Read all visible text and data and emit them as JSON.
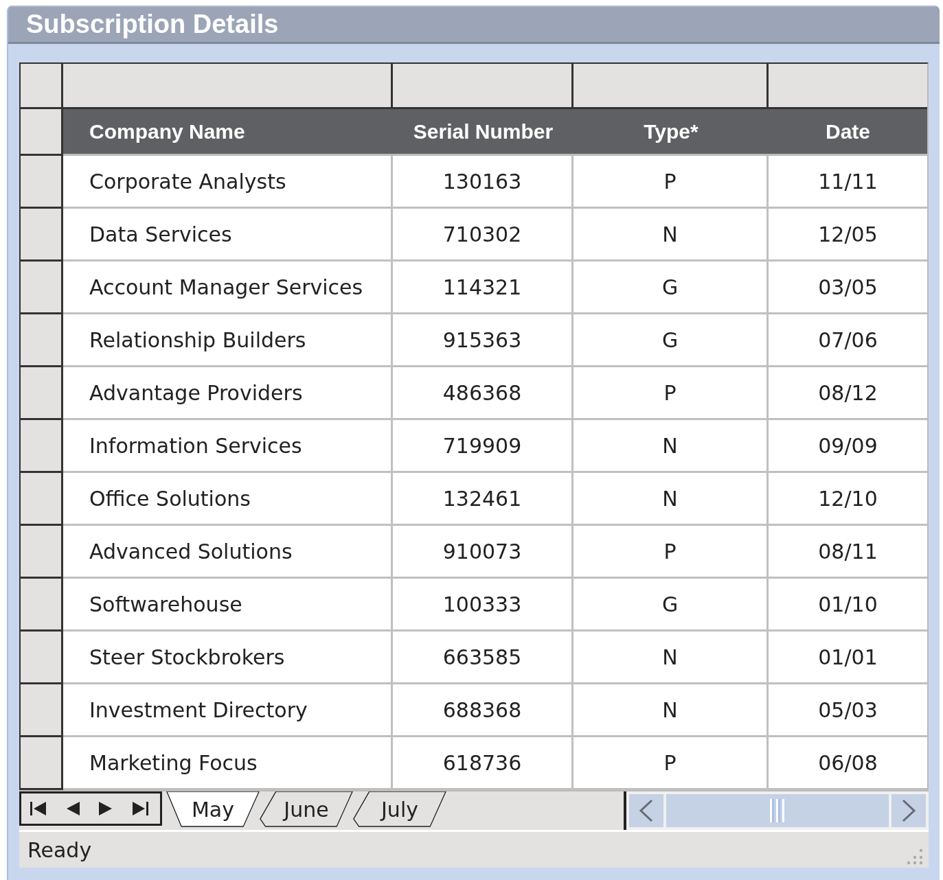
{
  "window": {
    "title": "Subscription Details"
  },
  "table": {
    "columns": [
      "Company Name",
      "Serial Number",
      "Type*",
      "Date"
    ],
    "rows": [
      [
        "Corporate Analysts",
        "130163",
        "P",
        "11/11"
      ],
      [
        "Data Services",
        "710302",
        "N",
        "12/05"
      ],
      [
        "Account Manager Services",
        "114321",
        "G",
        "03/05"
      ],
      [
        "Relationship Builders",
        "915363",
        "G",
        "07/06"
      ],
      [
        "Advantage Providers",
        "486368",
        "P",
        "08/12"
      ],
      [
        "Information Services",
        "719909",
        "N",
        "09/09"
      ],
      [
        "Office Solutions",
        "132461",
        "N",
        "12/10"
      ],
      [
        "Advanced Solutions",
        "910073",
        "P",
        "08/11"
      ],
      [
        "Softwarehouse",
        "100333",
        "G",
        "01/10"
      ],
      [
        "Steer Stockbrokers",
        "663585",
        "N",
        "01/01"
      ],
      [
        "Investment Directory",
        "688368",
        "N",
        "05/03"
      ],
      [
        "Marketing Focus",
        "618736",
        "P",
        "06/08"
      ]
    ]
  },
  "sheet_tabs": [
    {
      "label": "May",
      "selected": true
    },
    {
      "label": "June",
      "selected": false
    },
    {
      "label": "July",
      "selected": false
    }
  ],
  "status_bar": {
    "text": "Ready"
  }
}
